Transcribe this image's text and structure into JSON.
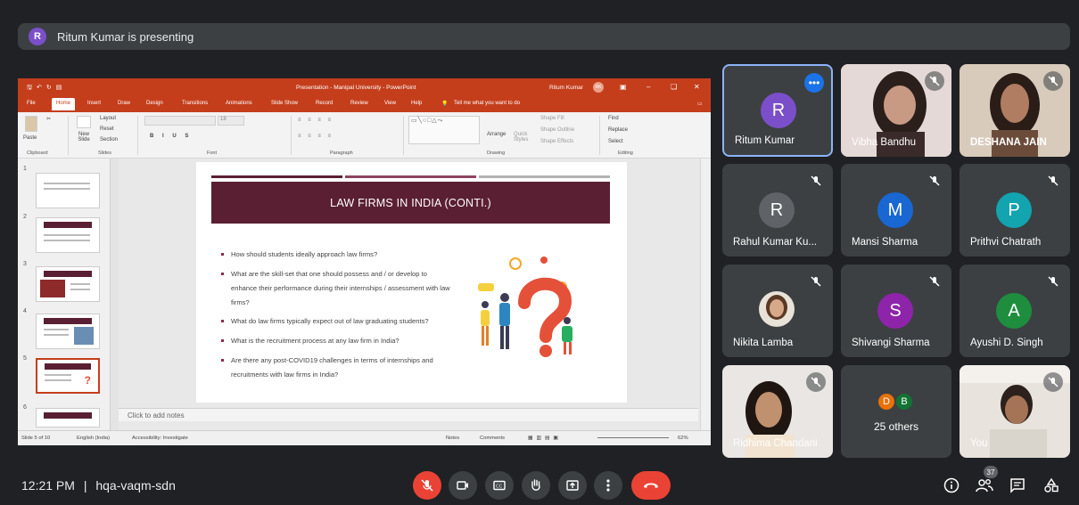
{
  "banner": {
    "avatar_letter": "R",
    "text": "Ritum Kumar is presenting"
  },
  "ppt": {
    "doc_title": "Presentation - Manipal University - PowerPoint",
    "user_name": "Ritum Kumar",
    "user_initials": "RK",
    "tabs": [
      "File",
      "Home",
      "Insert",
      "Draw",
      "Design",
      "Transitions",
      "Animations",
      "Slide Show",
      "Record",
      "Review",
      "View",
      "Help"
    ],
    "active_tab": "Home",
    "tell_me": "Tell me what you want to do",
    "ribbon": {
      "clipboard": "Clipboard",
      "paste": "Paste",
      "new_slide": "New Slide",
      "layout": "Layout",
      "reset": "Reset",
      "section": "Section",
      "slides": "Slides",
      "font": "Font",
      "font_size": "18",
      "paragraph": "Paragraph",
      "drawing": "Drawing",
      "arrange": "Arrange",
      "quick_styles": "Quick Styles",
      "shape_fill": "Shape Fill",
      "shape_outline": "Shape Outline",
      "shape_effects": "Shape Effects",
      "find": "Find",
      "replace": "Replace",
      "select": "Select",
      "editing": "Editing"
    },
    "slide_numbers": [
      "1",
      "2",
      "3",
      "4",
      "5",
      "6"
    ],
    "slide": {
      "title": "LAW FIRMS IN INDIA (CONTI.)",
      "bullets": [
        "How should students ideally approach law firms?",
        "What are the skill-set that one should possess and / or develop to enhance their performance during their internships / assessment with law firms?",
        "What do law firms typically expect out of law graduating students?",
        "What is the recruitment process at any law firm in India?",
        "Are there any post-COVID19 challenges in terms of internships and recruitments with law firms in India?"
      ]
    },
    "notes_placeholder": "Click to add notes",
    "status": {
      "slide_of": "Slide 5 of 10",
      "language": "English (India)",
      "accessibility": "Accessibility: Investigate",
      "notes": "Notes",
      "comments": "Comments",
      "zoom": "62%"
    }
  },
  "participants": [
    {
      "name": "Ritum Kumar",
      "initial": "R",
      "color": "#7b4fc9",
      "kind": "avatar",
      "muted": false,
      "active": true
    },
    {
      "name": "Vibha Bandhu",
      "kind": "photo",
      "muted": true
    },
    {
      "name": "DESHANA JAIN",
      "kind": "photo",
      "muted": true
    },
    {
      "name": "Rahul Kumar Ku...",
      "initial": "R",
      "color": "#5f6368",
      "kind": "avatar",
      "muted": true
    },
    {
      "name": "Mansi Sharma",
      "initial": "M",
      "color": "#1967d2",
      "kind": "avatar",
      "muted": true
    },
    {
      "name": "Prithvi Chatrath",
      "initial": "P",
      "color": "#12a4af",
      "kind": "avatar",
      "muted": true
    },
    {
      "name": "Nikita Lamba",
      "kind": "photo-avatar",
      "muted": true
    },
    {
      "name": "Shivangi Sharma",
      "initial": "S",
      "color": "#8e24aa",
      "kind": "avatar",
      "muted": true
    },
    {
      "name": "Ayushi D. Singh",
      "initial": "A",
      "color": "#1e8e3e",
      "kind": "avatar",
      "muted": true
    },
    {
      "name": "Ridhima Chandani",
      "kind": "photo",
      "muted": true
    },
    {
      "name": "25 others",
      "kind": "others",
      "muted": false,
      "mini": [
        {
          "initial": "D",
          "color": "#e8710a"
        },
        {
          "initial": "B",
          "color": "#137333"
        }
      ]
    },
    {
      "name": "You",
      "kind": "photo",
      "muted": true
    }
  ],
  "bottom": {
    "time": "12:21 PM",
    "separator": "|",
    "meeting_code": "hqa-vaqm-sdn",
    "people_count": "37"
  },
  "colors": {
    "accent": "#8ab4f8",
    "danger": "#ea4335",
    "ppt": "#c43e1c",
    "slide_maroon": "#5a1f33"
  }
}
